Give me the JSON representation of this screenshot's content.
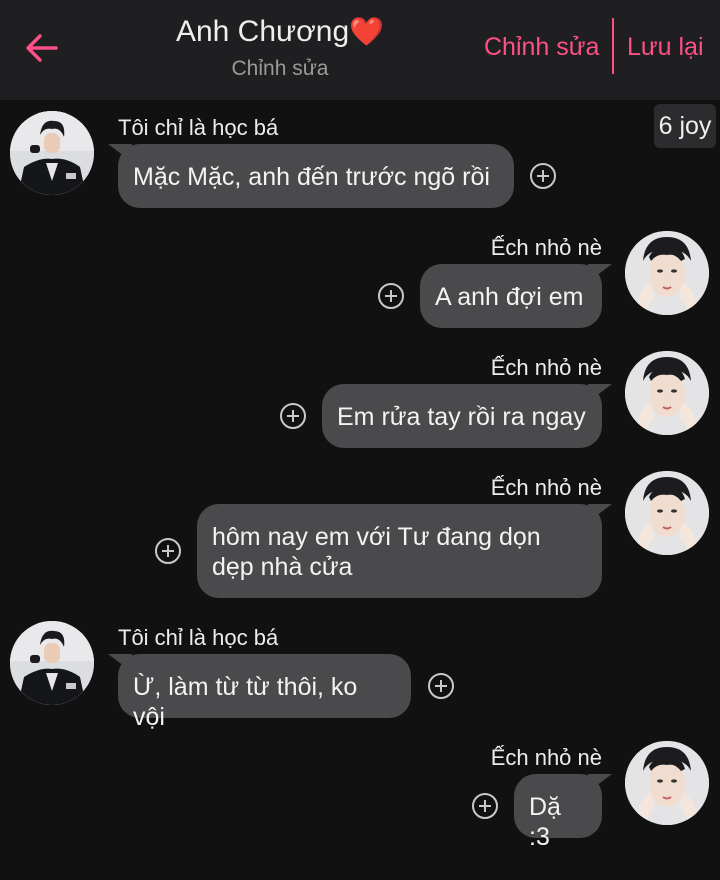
{
  "header": {
    "title": "Anh Chương",
    "title_emoji": "❤️",
    "subtitle": "Chỉnh sửa",
    "edit_label": "Chỉnh sửa",
    "save_label": "Lưu lại",
    "accent_color": "#ff4f8b"
  },
  "badge": {
    "label": "6 joy"
  },
  "people": {
    "left": {
      "name": "Tôi chỉ là học bá",
      "avatar": "avatar-dark-suit"
    },
    "right": {
      "name": "Ếch nhỏ nè",
      "avatar": "avatar-hands-on-cheeks"
    }
  },
  "messages": [
    {
      "sender": "Tôi chỉ là học bá",
      "text": "Mặc Mặc, anh đến trước ngõ rồi"
    },
    {
      "sender": "Ếch nhỏ nè",
      "text": "A anh đợi em"
    },
    {
      "sender": "Ếch nhỏ nè",
      "text": "Em rửa tay rồi ra ngay"
    },
    {
      "sender": "Ếch nhỏ nè",
      "text": "hôm nay em với Tư đang dọn dẹp nhà cửa"
    },
    {
      "sender": "Tôi chỉ là học bá",
      "text": "Ừ, làm từ từ thôi, ko vội"
    },
    {
      "sender": "Ếch nhỏ nè",
      "text": "Dặ :3"
    }
  ],
  "colors": {
    "background": "#111111",
    "header_bg": "#1f1f21",
    "bubble": "#4a4a4c"
  }
}
